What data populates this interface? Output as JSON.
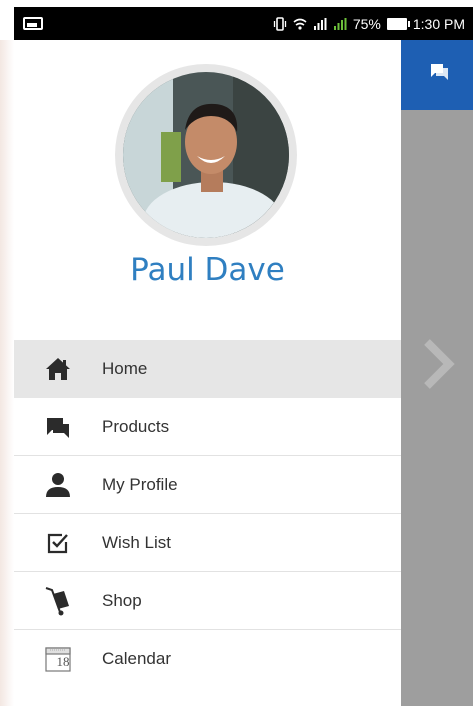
{
  "status_bar": {
    "battery": "75%",
    "time": "1:30 PM"
  },
  "profile": {
    "name": "Paul Dave"
  },
  "menu": {
    "items": [
      {
        "label": "Home",
        "icon": "home-icon",
        "active": true
      },
      {
        "label": "Products",
        "icon": "chat-icon",
        "active": false
      },
      {
        "label": "My Profile",
        "icon": "person-icon",
        "active": false
      },
      {
        "label": "Wish List",
        "icon": "checkbox-icon",
        "active": false
      },
      {
        "label": "Shop",
        "icon": "hand-truck-icon",
        "active": false
      },
      {
        "label": "Calendar",
        "icon": "calendar-icon",
        "active": false
      }
    ],
    "calendar_day": "18"
  },
  "colors": {
    "accent_blue": "#2f7fc1",
    "appbar_blue": "#1e5fb3",
    "active_item_bg": "#e6e6e6",
    "scrim": "#9e9e9e"
  }
}
